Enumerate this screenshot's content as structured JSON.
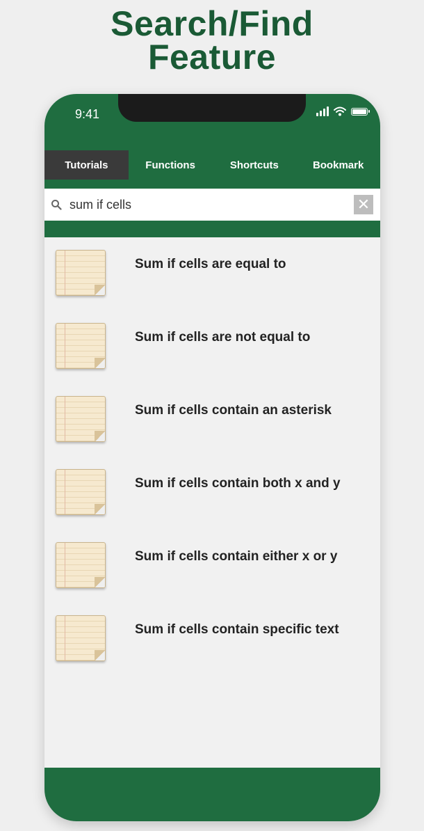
{
  "promo": {
    "title_line1": "Search/Find",
    "title_line2": "Feature"
  },
  "status_bar": {
    "time": "9:41",
    "icons": [
      "signal-icon",
      "wifi-icon",
      "battery-icon"
    ]
  },
  "tabs": [
    {
      "label": "Tutorials",
      "active": true
    },
    {
      "label": "Functions",
      "active": false
    },
    {
      "label": "Shortcuts",
      "active": false
    },
    {
      "label": "Bookmark",
      "active": false
    }
  ],
  "search": {
    "value": "sum if cells",
    "placeholder": "",
    "clear_label": "✕"
  },
  "results": [
    {
      "label": "Sum if cells are equal to",
      "icon": "notepad-icon"
    },
    {
      "label": "Sum if cells are not equal to",
      "icon": "notepad-icon"
    },
    {
      "label": "Sum if cells contain an asterisk",
      "icon": "notepad-icon"
    },
    {
      "label": "Sum if cells contain both x and y",
      "icon": "notepad-icon"
    },
    {
      "label": "Sum if cells contain either x or y",
      "icon": "notepad-icon"
    },
    {
      "label": "Sum if cells contain specific text",
      "icon": "notepad-icon"
    }
  ],
  "colors": {
    "brand_green": "#1f6d40",
    "title_green": "#1a5a35",
    "active_tab": "#3a3a3a"
  }
}
